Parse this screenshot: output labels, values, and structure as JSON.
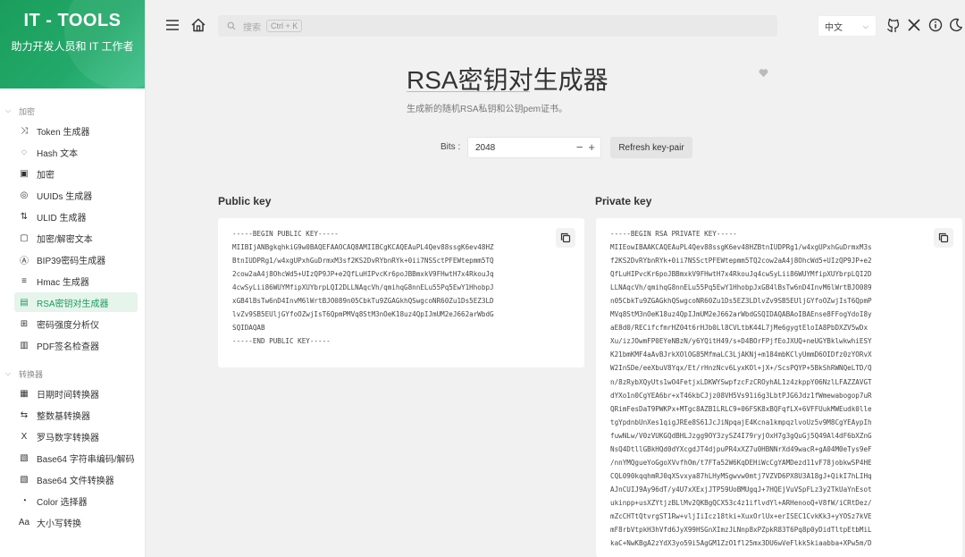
{
  "brand": {
    "title": "IT - TOOLS",
    "subtitle": "助力开发人员和 IT 工作者"
  },
  "nav": {
    "group1": "加密",
    "group1_items": [
      {
        "label": "Token 生成器",
        "icon": "shuffle-icon"
      },
      {
        "label": "Hash 文本",
        "icon": "eye-off-icon"
      },
      {
        "label": "加密",
        "icon": "lock-icon"
      },
      {
        "label": "UUIDs 生成器",
        "icon": "fingerprint-icon"
      },
      {
        "label": "ULID 生成器",
        "icon": "sort-icon"
      },
      {
        "label": "加密/解密文本",
        "icon": "lock-open-icon"
      },
      {
        "label": "BIP39密码生成器",
        "icon": "alpha-icon"
      },
      {
        "label": "Hmac 生成器",
        "icon": "short-text-icon"
      },
      {
        "label": "RSA密钥对生成器",
        "icon": "certificate-icon",
        "active": true
      },
      {
        "label": "密码强度分析仪",
        "icon": "password-icon"
      },
      {
        "label": "PDF签名检查器",
        "icon": "file-cert-icon"
      }
    ],
    "group2": "转换器",
    "group2_items": [
      {
        "label": "日期时间转换器",
        "icon": "calendar-icon"
      },
      {
        "label": "整数基转换器",
        "icon": "arrows-icon"
      },
      {
        "label": "罗马数字转换器",
        "icon": "letter-x-icon"
      },
      {
        "label": "Base64 字符串编码/解码",
        "icon": "file-digit-icon"
      },
      {
        "label": "Base64 文件转换器",
        "icon": "file-digit-icon"
      },
      {
        "label": "Color 选择器",
        "icon": "palette-icon"
      },
      {
        "label": "大小写转换",
        "icon": "letter-case-icon"
      }
    ]
  },
  "topbar": {
    "search_placeholder": "搜索",
    "search_shortcut": "Ctrl + K",
    "language": "中文"
  },
  "page": {
    "title": "RSA密钥对生成器",
    "description": "生成新的随机RSA私钥和公钥pem证书。"
  },
  "controls": {
    "bits_label": "Bits :",
    "bits_value": "2048",
    "refresh_label": "Refresh key-pair"
  },
  "public_key": {
    "label": "Public key",
    "text": "-----BEGIN PUBLIC KEY-----\nMIIBIjANBgkqhkiG9w0BAQEFAAOCAQ8AMIIBCgKCAQEAuPL4Qev88ssgK6ev48HZ\nBtnIUDPRg1/w4xgUPxhGuDrmxM3sf2KS2DvRYbnRYk+0ii7NSSctPFEWtepmm5TQ\n2cow2aA4j8OhcWd5+UIzQP9JP+e2QfLuHIPvcKr6poJBBmxkV9FHwtH7x4RkouJq\n4cwSyLii86WUYMfipXUYbrpLQI2DLLNAqcVh/qmihqG8nnELu55Pq5EwY1HhobpJ\nxGB4lBsTw6nD4InvM6lWrtBJO089n05CbkTu9ZGAGkhQSwgcoNR60Zu1Ds5EZ3LD\nlvZv9SB5EUljGYfoOZwjIsT6QpmPMVq8StM3nOeK18uz4QpIJmUM2eJ662arWbdG\nSQIDAQAB\n-----END PUBLIC KEY-----"
  },
  "private_key": {
    "label": "Private key",
    "text": "-----BEGIN RSA PRIVATE KEY-----\nMIIEowIBAAKCAQEAuPL4Qev88ssgK6ev48HZBtnIUDPRg1/w4xgUPxhGuDrmxM3s\nf2KS2DvRYbnRYk+0ii7NSSctPFEWtepmm5TQ2cow2aA4j8OhcWd5+UIzQP9JP+e2\nQfLuHIPvcKr6poJBBmxkV9FHwtH7x4RkouJq4cwSyLii86WUYMfipXUYbrpLQI2D\nLLNAqcVh/qmihqG8nnELu55Pq5EwY1HhobpJxGB4lBsTw6nD4InvM6lWrtBJO089\nn05CbkTu9ZGAGkhQSwgcoNR60Zu1Ds5EZ3LDlvZv9SB5EUljGYfoOZwjIsT6QpmP\nMVq8StM3nOeK18uz4QpIJmUM2eJ662arWbdGSQIDAQABAoIBAEnse8FFogYdoI8y\naE8d0/RECifcfmrHZ04t6rHJb0Ll8CVLtbK44L7jMe6gygtEloIA8PbDXZV5wDx\nXu/izJOwmFP0EYeNBzN/y6YQitH49/s+D4BOrFPjfEoJXUQ+neUGYBklwkwhiESY\nK21bmKMF4aAvBJrkXOlOG85MfmaLC3LjAKNj+m184mbKClyUmmD6OIDfz0zYORvX\nW2InSDe/eeXbuV8Yqx/Et/rHnzNcv6LyxKOl+jX+/ScsPQYP+5BkShRWNQeLTD/Q\nn/8zRybXQyUts1wO4FetjxLDKWYSwpfzcFzCROyhAL1z4zkppY06NzlLFAZZAVGT\ndYXo1n0CgYEA6br+xT46kbCJjz08VH5Vs91i6g3LbtPJG6Jdz1fWmewabogop7uR\nQRimFesDaT9PWKPx+MTgc8AZB1LRLC9+06FSK8xBQFqfLX+6VFFUukMWEudk0lle\ntgYpdnbUnXes1qigJREe8S61JcJiNpqajE4Kcna1kmpqzlvoUz5v9M8CgYEAypIh\nfuwNLw/V0zVUKGQdBHLJzgg9OY3zySZ4I79ryjOxH7g3gQuGj5Q49Al4dF6bXZnG\nNsQ4DtllGBkHQd0dYXcgdJT4djpuPR4xXZ7u0HBNNrXd49wacR+gA04M0eTys9eF\n/nnYMQgueYoGgoXVvfhOm/t7FTa52W6KqDEHiWcCgYAMDezd11vF78jobkwSP4HE\nCQL090kqqhmRJ0qXSvxya87hLHyMSgwvw0mtj7VZVD6PX8U3A18gJ+QikI7hLIHq\nAJnCUIJ9Ay96dT/y4U7xXExjJTP59UoBMUgqJ+7HQEjVuVSpFLz3y2TkUaYnEsot\nukinpp+usXZYtjzBLlMv2QKBgQCX53c4z1iflvdYl+ARHenooQ+V8fW/iCRtDez/\nmZcCHTtQtvrgST1Rw+vljIiIcz18tki+XuxOrlUx+erISEC1CvkKk3+yYOSz7kVE\nmF8rbVtpkH3hVfd6JyX99HSGnXImzJLNnp8xPZpkR83T6Pq8p0yDidTltpEtbMiL\nkaC+NwKBgA2zYdX3yo59i5AgGM1ZzO1fl25mx3DU6wVeFlkk5kiaabba+XPw5m/D"
  },
  "icons": {
    "accent": "#18a058"
  }
}
